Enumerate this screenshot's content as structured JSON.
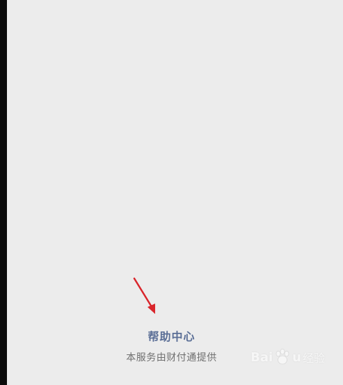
{
  "footer": {
    "help_center_label": "帮助中心",
    "provider_text": "本服务由财付通提供"
  },
  "watermark": {
    "text_prefix": "Bai",
    "text_suffix": "u",
    "text_cn": "经验"
  },
  "colors": {
    "background": "#ececec",
    "link": "#5a6e96",
    "secondary_text": "#6f6f6f",
    "annotation_arrow": "#d9262c"
  },
  "icons": {
    "arrow": "annotation-arrow-icon",
    "watermark_logo": "baidu-paw-icon"
  }
}
